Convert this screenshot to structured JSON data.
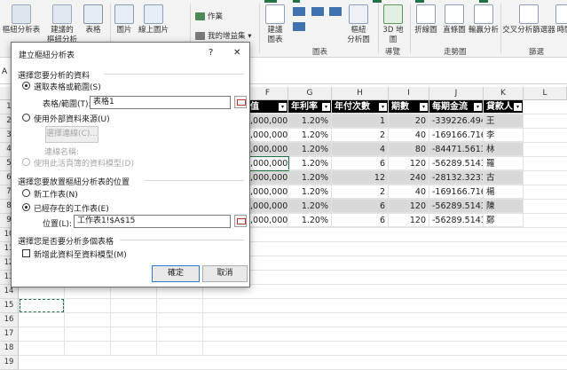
{
  "ribbon": {
    "groups": {
      "pivot_recommended": "樞紐分析表",
      "recommended_pivot": "建議的",
      "recommended_pivot_2": "樞紐分析表",
      "table": "表格",
      "pictures": "圖片",
      "online_pictures": "線上圖片",
      "shapes": "作業",
      "my_addins": "我的增益集",
      "recommended_charts": "建議",
      "recommended_charts_2": "圖表",
      "pivot_chart": "樞紐",
      "pivot_chart_2": "分析圖",
      "map3d": "3D 地",
      "map3d_2": "圖",
      "line": "折線圖",
      "column": "直條圖",
      "winloss": "輸贏分析",
      "slicer": "交叉分析篩選器",
      "timeline": "時間"
    },
    "group_labels": {
      "charts": "圖表",
      "tours": "導覽",
      "sparklines": "走勢圖",
      "filters": "篩選"
    }
  },
  "grid": {
    "columns": [
      "F",
      "G",
      "H",
      "I",
      "J",
      "K",
      "L"
    ],
    "name_box_partial": "A",
    "rows": [
      "1",
      "2",
      "3",
      "4",
      "5",
      "6",
      "7",
      "8",
      "9",
      "10",
      "11",
      "12",
      "13",
      "14",
      "15",
      "16",
      "17",
      "18",
      "19"
    ],
    "headers": [
      "值",
      "年利率",
      "年付次數",
      "期數",
      "每期金流",
      "貸款人"
    ],
    "data": [
      {
        "f": ",000,000",
        "g": "1.20%",
        "h": "1",
        "i": "20",
        "j": "-339226.494",
        "k": "王"
      },
      {
        "f": ",000,000",
        "g": "1.20%",
        "h": "2",
        "i": "40",
        "j": "-169166.716",
        "k": "李"
      },
      {
        "f": ",000,000",
        "g": "1.20%",
        "h": "4",
        "i": "80",
        "j": "-84471.5613",
        "k": "林"
      },
      {
        "f": ",000,000",
        "g": "1.20%",
        "h": "6",
        "i": "120",
        "j": "-56289.5143",
        "k": "羅"
      },
      {
        "f": ",000,000",
        "g": "1.20%",
        "h": "12",
        "i": "240",
        "j": "-28132.3231",
        "k": "古"
      },
      {
        "f": ",000,000",
        "g": "1.20%",
        "h": "2",
        "i": "40",
        "j": "-169166.716",
        "k": "楊"
      },
      {
        "f": ",000,000",
        "g": "1.20%",
        "h": "6",
        "i": "120",
        "j": "-56289.5143",
        "k": "陳"
      },
      {
        "f": ",000,000",
        "g": "1.20%",
        "h": "6",
        "i": "120",
        "j": "-56289.5143",
        "k": "鄭"
      }
    ]
  },
  "dialog": {
    "title": "建立樞紐分析表",
    "help": "?",
    "close": "✕",
    "section_data": "選擇您要分析的資料",
    "opt_select_range": "選取表格或範圍(S)",
    "table_range_label": "表格/範圍(T):",
    "table_range_value": "表格1",
    "opt_external": "使用外部資料來源(U)",
    "choose_connection": "選擇連線(C)...",
    "connection_name": "連線名稱:",
    "opt_data_model": "使用此活頁簿的資料模型(D)",
    "section_location": "選擇您要放置樞紐分析表的位置",
    "opt_new_sheet": "新工作表(N)",
    "opt_existing_sheet": "已經存在的工作表(E)",
    "location_label": "位置(L):",
    "location_value": "工作表1!$A$15",
    "section_multi": "選擇您是否要分析多個表格",
    "add_to_model": "新增此資料至資料模型(M)",
    "ok": "確定",
    "cancel": "取消"
  }
}
